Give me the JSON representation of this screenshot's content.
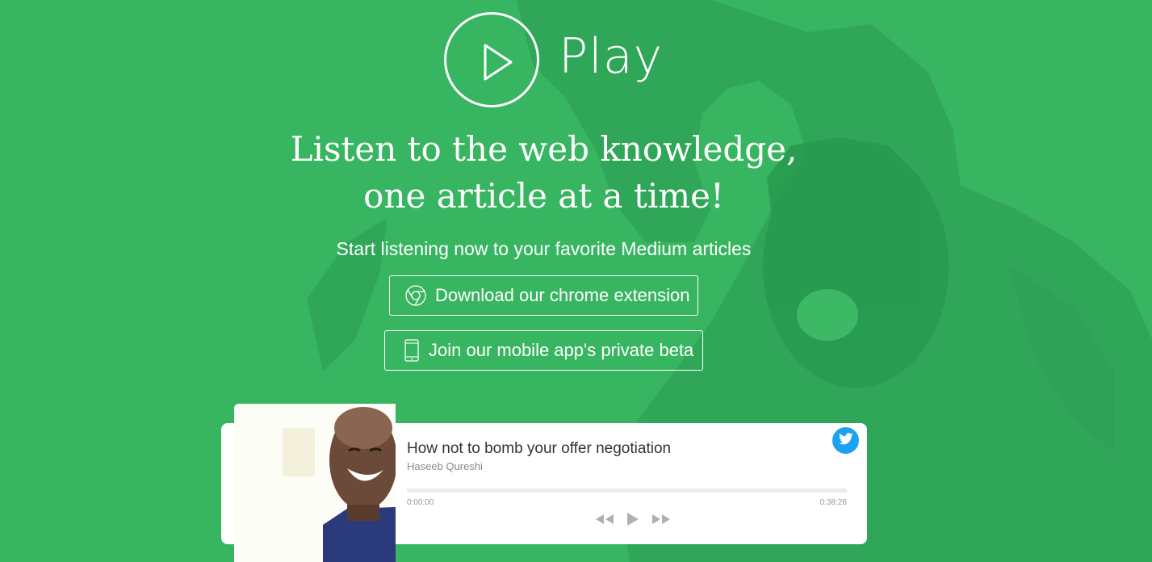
{
  "brand": {
    "name": "Play",
    "logo_icon": "play-circle-icon"
  },
  "hero": {
    "headline_line1": "Listen to the web knowledge,",
    "headline_line2": "one article at a time!",
    "subheadline": "Start listening now to your favorite Medium articles"
  },
  "cta": {
    "chrome_label": "Download our chrome extension",
    "chrome_icon": "chrome-icon",
    "beta_label": "Join our mobile app's private beta",
    "beta_icon": "smartphone-icon"
  },
  "player": {
    "title": "How not to bomb your offer negotiation",
    "author": "Haseeb Qureshi",
    "time_elapsed": "0:00:00",
    "time_total": "0:38:28",
    "progress": 0,
    "share_icon": "twitter-icon",
    "controls": [
      "rewind-icon",
      "play-icon",
      "fast-forward-icon"
    ]
  },
  "colors": {
    "background": "#38b561",
    "twitter": "#1da1f2",
    "text_dark": "#333333",
    "text_muted": "#8a8a8a"
  }
}
